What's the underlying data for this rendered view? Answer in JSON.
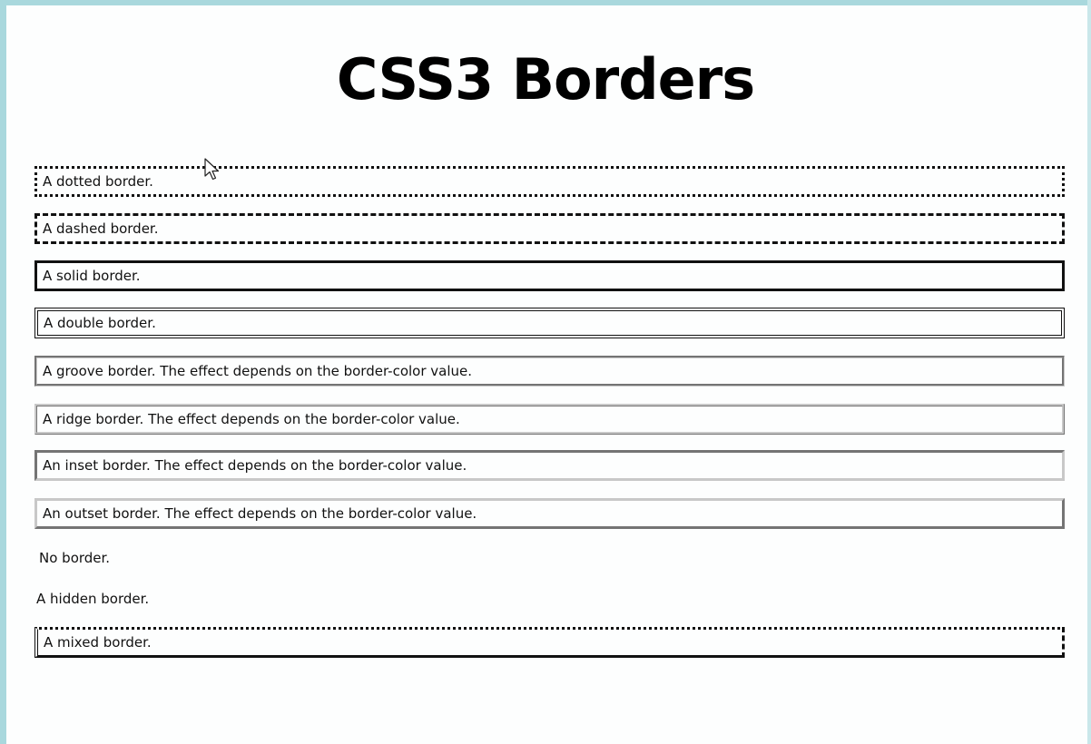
{
  "page": {
    "title": "CSS3 Borders",
    "frame_color": "#a9d8dd"
  },
  "borders": {
    "dotted": "A dotted border.",
    "dashed": "A dashed border.",
    "solid": "A solid border.",
    "double": "A double border.",
    "groove": "A groove border. The effect depends on the border-color value.",
    "ridge": "A ridge border. The effect depends on the border-color value.",
    "inset": "An inset border. The effect depends on the border-color value.",
    "outset": "An outset border. The effect depends on the border-color value.",
    "none": "No border.",
    "hidden": "A hidden border.",
    "mixed": "A mixed border."
  },
  "cursor": {
    "icon": "mouse-pointer-icon"
  }
}
